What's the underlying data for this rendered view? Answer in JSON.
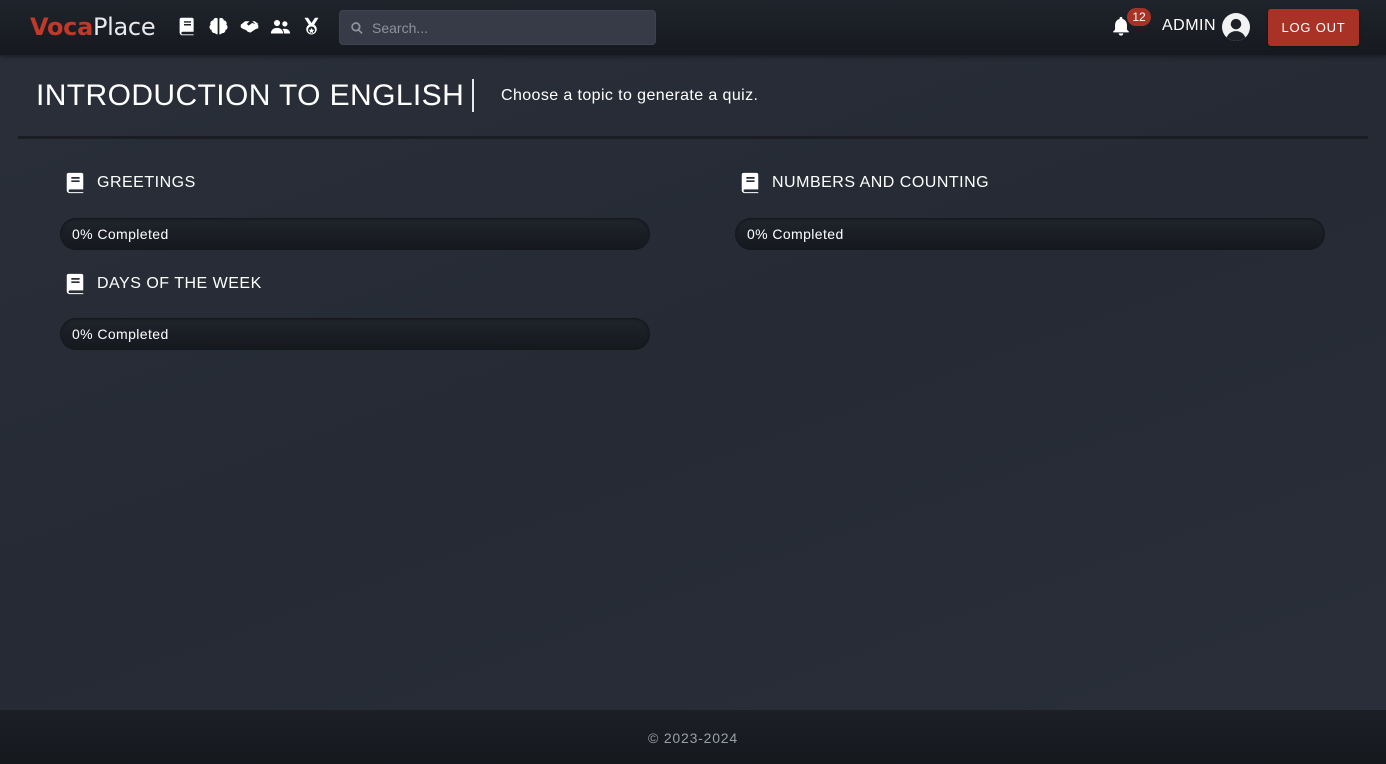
{
  "navbar": {
    "brand_part1": "Voca",
    "brand_part2": "Place",
    "icons": [
      "book-icon",
      "brain-icon",
      "handshake-icon",
      "users-icon",
      "medal-icon"
    ],
    "search_placeholder": "Search...",
    "notification_count": "12",
    "user_name": "ADMIN",
    "logout_label": "LOG OUT"
  },
  "header": {
    "title": "INTRODUCTION TO ENGLISH",
    "subtitle": "Choose a topic to generate a quiz."
  },
  "topics": [
    {
      "name": "GREETINGS",
      "progress_label": "0% Completed",
      "progress": 0
    },
    {
      "name": "NUMBERS AND COUNTING",
      "progress_label": "0% Completed",
      "progress": 0
    },
    {
      "name": "DAYS OF THE WEEK",
      "progress_label": "0% Completed",
      "progress": 0
    }
  ],
  "footer": {
    "text": "© 2023-2024"
  },
  "colors": {
    "accent": "#a93226",
    "background": "#2a2f3a",
    "navbar": "#1b1e25"
  }
}
